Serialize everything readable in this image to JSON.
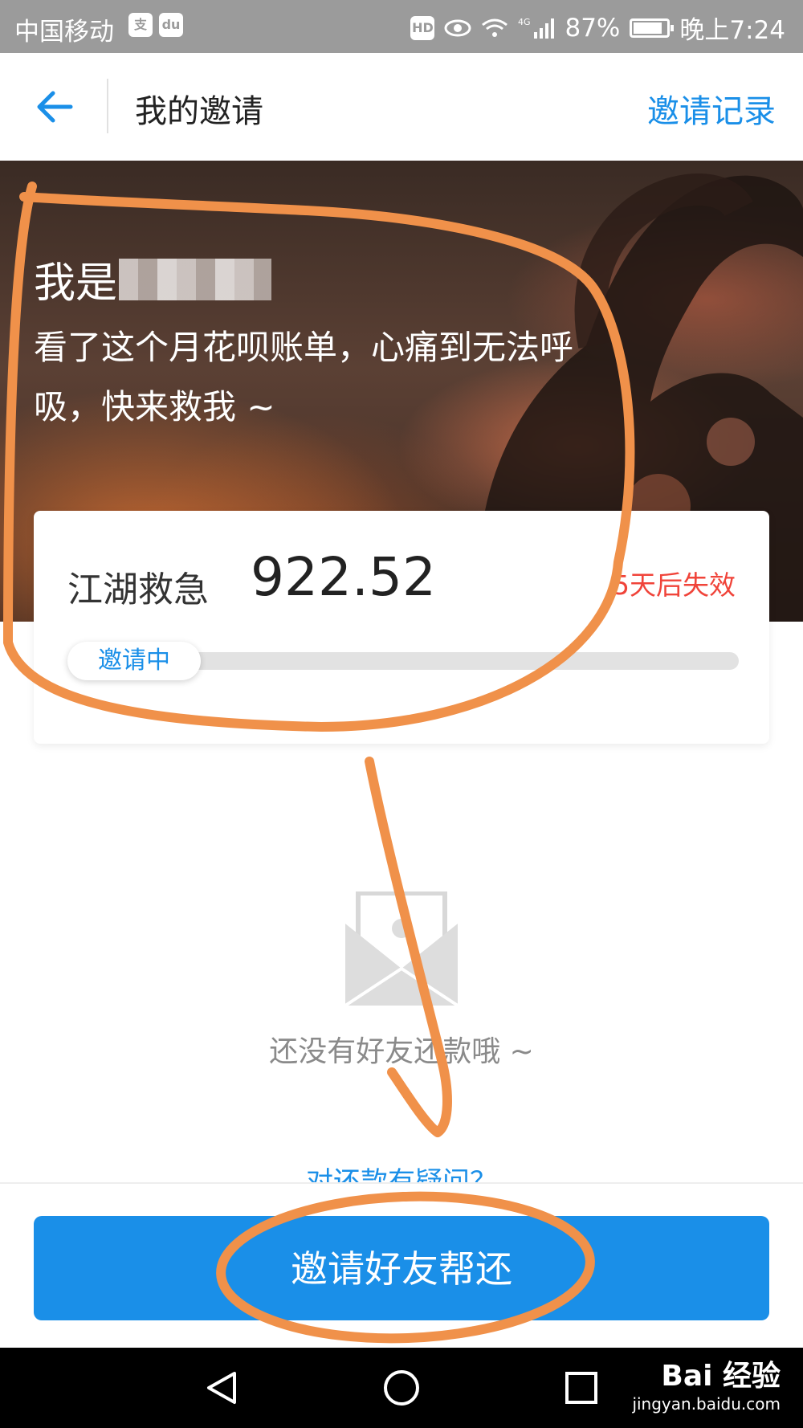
{
  "status_bar": {
    "carrier": "中国移动",
    "battery": "87%",
    "battery_level": 0.87,
    "time": "晚上7:24",
    "icons": [
      "alipay-icon",
      "baidu-maps-icon",
      "hd-icon",
      "eye-icon",
      "wifi-icon",
      "4g-signal-icon",
      "battery-icon"
    ],
    "hd_label": "HD"
  },
  "nav": {
    "back_icon": "arrow-left-icon",
    "title": "我的邀请",
    "action": "邀请记录"
  },
  "banner": {
    "name_prefix": "我是",
    "message": "看了这个月花呗账单，心痛到无法呼吸，快来救我 ~"
  },
  "card": {
    "label": "江湖救急",
    "amount": "922.52",
    "expire": "5天后失效",
    "status": "邀请中",
    "progress": 0.0
  },
  "empty_state": {
    "icon": "envelope-icon",
    "text": "还没有好友还款哦 ~",
    "help_link": "对还款有疑问？"
  },
  "bottom": {
    "button_label": "邀请好友帮还"
  },
  "system_nav": {
    "icons": [
      "back-triangle-icon",
      "home-circle-icon",
      "recents-square-icon"
    ]
  },
  "watermark": {
    "main": "Bai 经验",
    "sub": "jingyan.baidu.com"
  },
  "colors": {
    "accent": "#1a8fe8",
    "warning": "#f0443a",
    "annotation": "#f0914a"
  }
}
